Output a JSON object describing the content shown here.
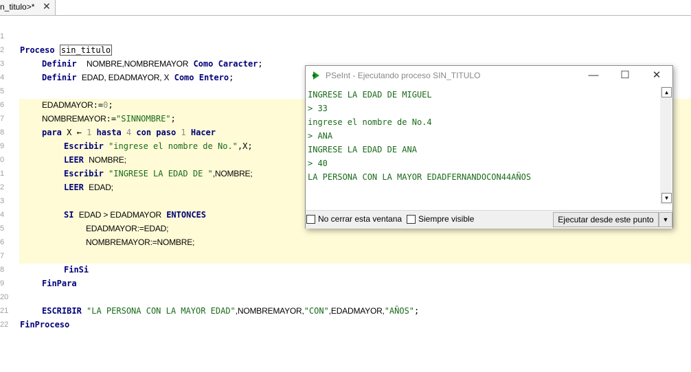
{
  "tab": {
    "label": "n_titulo>*",
    "close": "✕"
  },
  "editor": {
    "lines": [
      "1",
      "2",
      "3",
      "4",
      "5",
      "6",
      "7",
      "8",
      "9",
      "0",
      "1",
      "2",
      "3",
      "4",
      "5",
      "6",
      "7",
      "8",
      "9",
      "20",
      "21",
      "22"
    ],
    "code": {
      "l1": {
        "kw": "Proceso",
        "name": "sin_titulo"
      },
      "l2": {
        "kw1": "Definir",
        "ids": "NOMBRE,NOMBREMAYOR",
        "kw2": "Como",
        "kw3": "Caracter",
        "end": ";"
      },
      "l3": {
        "kw1": "Definir",
        "ids": "EDAD, EDADMAYOR, X",
        "kw2": "Como",
        "kw3": "Entero",
        "end": ";"
      },
      "l5": {
        "id": "EDADMAYOR",
        "op": ":=",
        "num": "0",
        "end": ";"
      },
      "l6": {
        "id": "NOMBREMAYOR",
        "op": ":=",
        "str": "\"SINNOMBRE\"",
        "end": ";"
      },
      "l7": {
        "kw1": "para",
        "id": "X",
        "arrow": "←",
        "num1": "1",
        "kw2": "hasta",
        "num2": "4",
        "kw3": "con paso",
        "num3": "1",
        "kw4": "Hacer"
      },
      "l8": {
        "kw": "Escribir",
        "str": "\"ingrese el nombre de No.\"",
        "rest": ",X;"
      },
      "l9": {
        "kw": "LEER",
        "rest": "NOMBRE;"
      },
      "l10": {
        "kw": "Escribir",
        "str": "\"INGRESE LA EDAD DE \"",
        "rest": ",NOMBRE;"
      },
      "l11": {
        "kw": "LEER",
        "rest": "EDAD;"
      },
      "l13": {
        "kw1": "SI",
        "cond": "EDAD > EDADMAYOR",
        "kw2": "ENTONCES"
      },
      "l14": {
        "text": "EDADMAYOR:=EDAD;"
      },
      "l15": {
        "text": "NOMBREMAYOR:=NOMBRE;"
      },
      "l17": {
        "kw": "FinSi"
      },
      "l18": {
        "kw": "FinPara"
      },
      "l20": {
        "kw": "ESCRIBIR",
        "str1": "\"LA PERSONA CON LA MAYOR EDAD\"",
        "mid1": ",NOMBREMAYOR,",
        "str2": "\"CON\"",
        "mid2": ",EDADMAYOR,",
        "str3": "\"AÑOS\"",
        "end": ";"
      },
      "l21": {
        "kw": "FinProceso"
      }
    }
  },
  "console_window": {
    "title": "PSeInt - Ejecutando proceso SIN_TITULO",
    "minimize": "—",
    "maximize": "☐",
    "close": "✕",
    "output": [
      "INGRESE LA EDAD DE MIGUEL",
      "> 33",
      "ingrese el nombre de No.4",
      "> ANA",
      "INGRESE LA EDAD DE ANA",
      "> 40",
      "LA PERSONA CON LA MAYOR EDADFERNANDOCON44AÑOS"
    ],
    "no_close_label": "No cerrar esta ventana",
    "always_visible_label": "Siempre visible",
    "run_button": "Ejecutar desde este punto",
    "scroll_up": "▲",
    "scroll_down": "▼",
    "run_dropdown": "▼"
  },
  "colors": {
    "keyword": "#00007a",
    "string": "#1a6a1a",
    "highlight": "#fefbd6",
    "console_text": "#1a6a1a"
  },
  "icons": {
    "app": "pseint-icon"
  }
}
